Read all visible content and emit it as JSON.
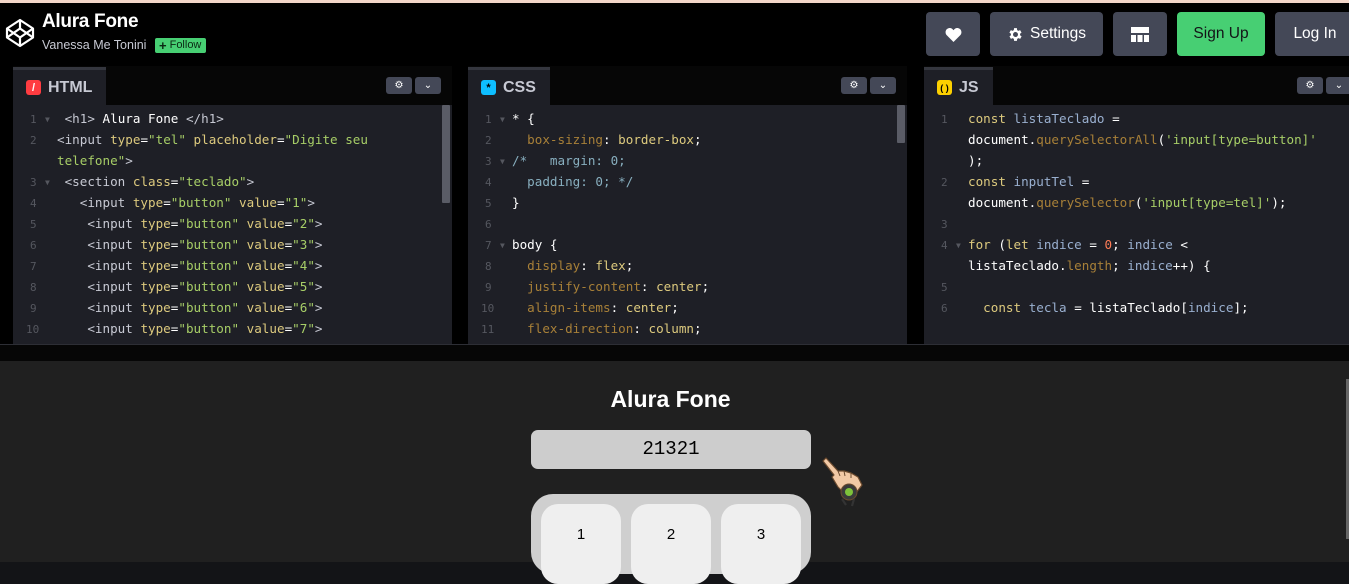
{
  "header": {
    "pen_title": "Alura Fone",
    "author": "Vanessa Me Tonini",
    "follow_label": "Follow",
    "settings_label": "Settings",
    "signup_label": "Sign Up",
    "login_label": "Log In"
  },
  "editors": {
    "html": {
      "tab_label": "HTML",
      "lines": [
        {
          "n": "1",
          "text": " <h1> Alura Fone </h1>"
        },
        {
          "n": "2",
          "text": "<input type=\"tel\" placeholder=\"Digite seu"
        },
        {
          "n": "",
          "text": "telefone\">"
        },
        {
          "n": "3",
          "text": " <section class=\"teclado\">"
        },
        {
          "n": "4",
          "text": "   <input type=\"button\" value=\"1\">"
        },
        {
          "n": "5",
          "text": "    <input type=\"button\" value=\"2\">"
        },
        {
          "n": "6",
          "text": "    <input type=\"button\" value=\"3\">"
        },
        {
          "n": "7",
          "text": "    <input type=\"button\" value=\"4\">"
        },
        {
          "n": "8",
          "text": "    <input type=\"button\" value=\"5\">"
        },
        {
          "n": "9",
          "text": "    <input type=\"button\" value=\"6\">"
        },
        {
          "n": "10",
          "text": "    <input type=\"button\" value=\"7\">"
        }
      ]
    },
    "css": {
      "tab_label": "CSS",
      "lines": [
        {
          "n": "1",
          "text": "* {"
        },
        {
          "n": "2",
          "text": "  box-sizing: border-box;"
        },
        {
          "n": "3",
          "text": "/*   margin: 0;"
        },
        {
          "n": "4",
          "text": "  padding: 0; */"
        },
        {
          "n": "5",
          "text": "}"
        },
        {
          "n": "6",
          "text": ""
        },
        {
          "n": "7",
          "text": "body {"
        },
        {
          "n": "8",
          "text": "  display: flex;"
        },
        {
          "n": "9",
          "text": "  justify-content: center;"
        },
        {
          "n": "10",
          "text": "  align-items: center;"
        },
        {
          "n": "11",
          "text": "  flex-direction: column;"
        }
      ]
    },
    "js": {
      "tab_label": "JS",
      "lines": [
        {
          "n": "1",
          "text": "const listaTeclado ="
        },
        {
          "n": "",
          "text": "document.querySelectorAll('input[type=button]'"
        },
        {
          "n": "",
          "text": ");"
        },
        {
          "n": "2",
          "text": "const inputTel ="
        },
        {
          "n": "",
          "text": "document.querySelector('input[type=tel]');"
        },
        {
          "n": "3",
          "text": ""
        },
        {
          "n": "4",
          "text": "for (let indice = 0; indice <"
        },
        {
          "n": "",
          "text": "listaTeclado.length; indice++) {"
        },
        {
          "n": "5",
          "text": ""
        },
        {
          "n": "6",
          "text": "  const tecla = listaTeclado[indice];"
        }
      ]
    }
  },
  "preview": {
    "heading": "Alura Fone",
    "phone_value": "21321",
    "keys": [
      "1",
      "2",
      "3"
    ]
  }
}
